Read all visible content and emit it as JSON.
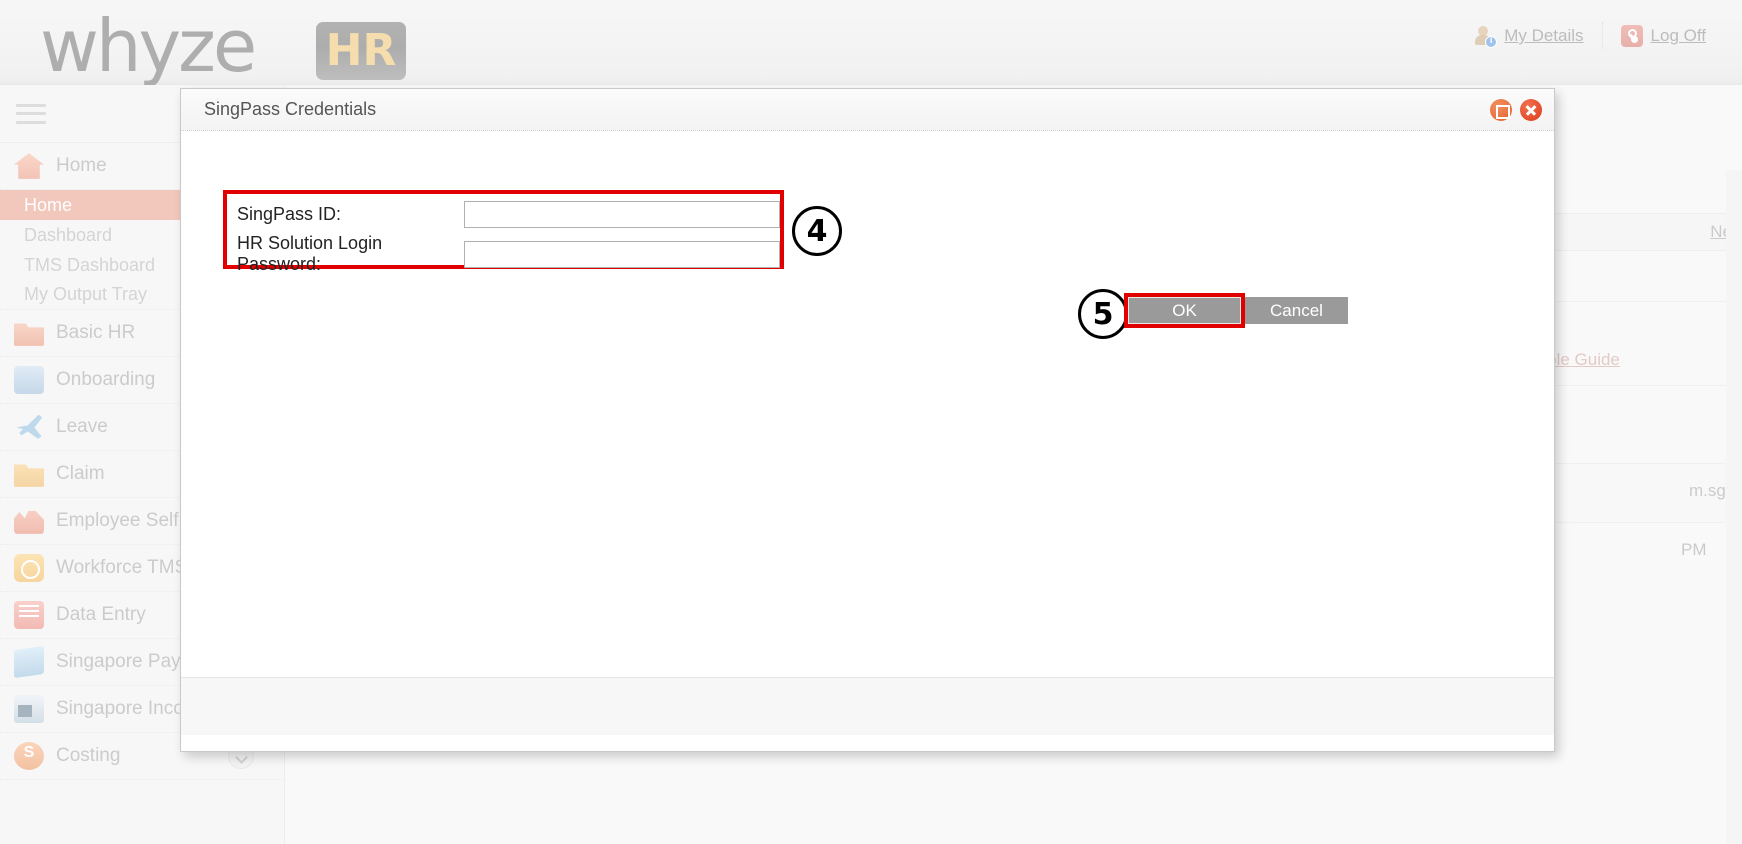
{
  "app": {
    "brand_primary": "whyze",
    "brand_secondary": "HR",
    "accent_orange": "#e2795a",
    "highlight_red": "#e00000"
  },
  "header": {
    "my_details_label": "My Details",
    "log_off_label": "Log Off"
  },
  "sidebar": {
    "items": [
      {
        "label": "Home",
        "icon": "home-icon",
        "chevron": false
      },
      {
        "label": "Basic HR",
        "icon": "folder-icon",
        "chevron": false
      },
      {
        "label": "Onboarding",
        "icon": "handshake-icon",
        "chevron": false
      },
      {
        "label": "Leave",
        "icon": "plane-icon",
        "chevron": false
      },
      {
        "label": "Claim",
        "icon": "claim-folder-icon",
        "chevron": false
      },
      {
        "label": "Employee Self Se",
        "icon": "people-icon",
        "chevron": false
      },
      {
        "label": "Workforce TMS",
        "icon": "clock-icon",
        "chevron": false
      },
      {
        "label": "Data Entry",
        "icon": "keyboard-icon",
        "chevron": false
      },
      {
        "label": "Singapore Payroll",
        "icon": "payroll-icon",
        "chevron": false
      },
      {
        "label": "Singapore Income Tax",
        "icon": "tax-calculator-icon",
        "chevron": true
      },
      {
        "label": "Costing",
        "icon": "costing-icon",
        "chevron": true
      }
    ],
    "home_subitems": [
      {
        "label": "Home",
        "active": true
      },
      {
        "label": "Dashboard",
        "active": false
      },
      {
        "label": "TMS Dashboard",
        "active": false
      },
      {
        "label": "My Output Tray",
        "active": false
      }
    ]
  },
  "background_content": {
    "need_help_label": "Need Help?",
    "role_guide_label": "er Role Guide",
    "email_fragment": "m.sg",
    "time_fragment": "PM"
  },
  "dialog": {
    "title": "SingPass Credentials",
    "window_controls": {
      "restore": "restore-icon",
      "close": "close-icon"
    },
    "fields": [
      {
        "label": "SingPass ID:",
        "value": "",
        "placeholder": "",
        "type": "text",
        "name": "singpass-id-input"
      },
      {
        "label": "HR Solution Login Password:",
        "value": "",
        "placeholder": "",
        "type": "password",
        "name": "hr-password-input"
      }
    ],
    "buttons": {
      "ok_label": "OK",
      "cancel_label": "Cancel"
    }
  },
  "annotations": {
    "step_fields": "4",
    "step_ok": "5"
  }
}
